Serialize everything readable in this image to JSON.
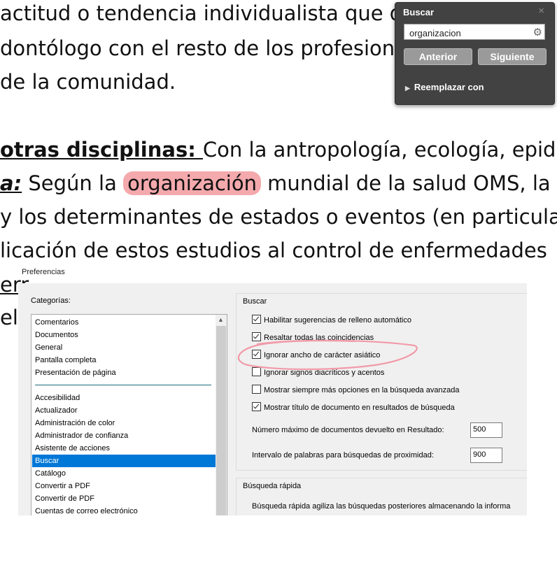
{
  "document": {
    "line1": "actitud o tendencia individualista que d",
    "line2": "dontólogo con el resto de los profesion",
    "line3": "de la comunidad.",
    "line4_bold": "otras disciplinas: ",
    "line4_rest": "Con la antropología, ecología, epide",
    "line5_label": "a:",
    "line5_pre": " Según la ",
    "line5_hit": "organización",
    "line5_post": " mundial de la salud OMS, la e",
    "line6": "y los determinantes de estados o eventos (en particula",
    "line7": "licación de estos estudios al control de enfermedades",
    "line8": "err",
    "line9": "el"
  },
  "find": {
    "title": "Buscar",
    "close": "×",
    "query": "organizacion",
    "prev_label": "Anterior",
    "next_label": "Siguiente",
    "replace_label": "Reemplazar con"
  },
  "preferences": {
    "caption": "Preferencias",
    "categories_label": "Categorías:",
    "categories_top": [
      "Comentarios",
      "Documentos",
      "General",
      "Pantalla completa",
      "Presentación de página"
    ],
    "categories": [
      "Accesibilidad",
      "Actualizador",
      "Administración de color",
      "Administrador de confianza",
      "Asistente de acciones",
      "Buscar",
      "Catálogo",
      "Convertir a PDF",
      "Convertir de PDF",
      "Cuentas de correo electrónico"
    ],
    "selected_category": "Buscar",
    "search_group": "Buscar",
    "options": [
      {
        "label": "Habilitar sugerencias de relleno automático",
        "checked": true
      },
      {
        "label": "Resaltar todas las coincidencias",
        "checked": true
      },
      {
        "label": "Ignorar ancho de carácter asiático",
        "checked": true
      },
      {
        "label": "Ignorar signos diacríticos y acentos",
        "checked": false
      },
      {
        "label": "Mostrar siempre más opciones en la búsqueda avanzada",
        "checked": false
      },
      {
        "label": "Mostrar título de documento en resultados de búsqueda",
        "checked": true
      }
    ],
    "max_docs_label": "Número máximo de documentos devuelto en Resultado:",
    "max_docs_value": "500",
    "proximity_label": "Intervalo de palabras para búsquedas de proximidad:",
    "proximity_value": "900",
    "quick_group": "Búsqueda rápida",
    "quick_desc": "Búsqueda rápida agiliza las búsquedas posteriores almacenando la informa"
  },
  "colors": {
    "highlight": "#f4a9ad",
    "find_panel_bg": "#424242",
    "selection": "#0078d7",
    "annotation": "#f19aa8"
  }
}
